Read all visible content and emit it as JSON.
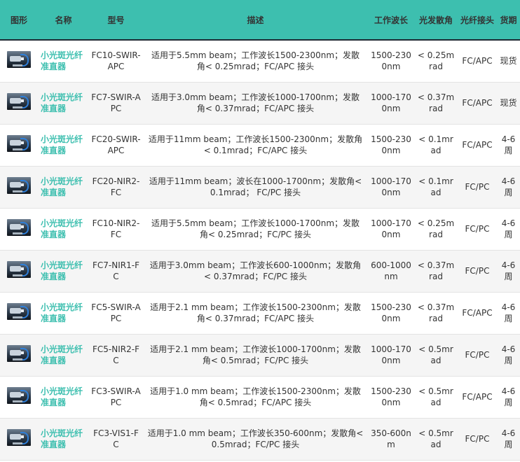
{
  "header": {
    "image": "图形",
    "name": "名称",
    "model": "型号",
    "description": "描述",
    "wavelength": "工作波长",
    "divergence": "光发散角",
    "connector": "光纤接头",
    "lead_time": "货期"
  },
  "rows": [
    {
      "icon": "fiber-collimator-icon",
      "name": "小光斑光纤准直器",
      "model": "FC10-SWIR-APC",
      "description": "适用于5.5mm beam；工作波长1500-2300nm；发散角< 0.25mrad；FC/APC 接头",
      "wavelength": "1500-2300nm",
      "divergence": "< 0.25mrad",
      "connector": "FC/APC",
      "lead_time": "现货"
    },
    {
      "icon": "fiber-collimator-icon",
      "name": "小光斑光纤准直器",
      "model": "FC7-SWIR-APC",
      "description": "适用于3.0mm beam；工作波长1000-1700nm；发散角< 0.37mrad；FC/APC 接头",
      "wavelength": "1000-1700nm",
      "divergence": "< 0.37mrad",
      "connector": "FC/APC",
      "lead_time": "现货"
    },
    {
      "icon": "fiber-collimator-icon",
      "name": "小光斑光纤准直器",
      "model": "FC20-SWIR-APC",
      "description": "适用于11mm beam；工作波长1500-2300nm；发散角< 0.1mrad；FC/APC 接头",
      "wavelength": "1500-2300nm",
      "divergence": "< 0.1mrad",
      "connector": "FC/APC",
      "lead_time": "4-6周"
    },
    {
      "icon": "fiber-collimator-icon",
      "name": "小光斑光纤准直器",
      "model": "FC20-NIR2-FC",
      "description": "适用于11mm beam；波长在1000-1700nm；发散角< 0.1mrad； FC/PC 接头",
      "wavelength": "1000-1700nm",
      "divergence": "< 0.1mrad",
      "connector": "FC/PC",
      "lead_time": "4-6周"
    },
    {
      "icon": "fiber-collimator-icon",
      "name": "小光斑光纤准直器",
      "model": "FC10-NIR2-FC",
      "description": "适用于5.5mm beam；工作波长1000-1700nm；发散角< 0.25mrad；FC/PC 接头",
      "wavelength": "1000-1700nm",
      "divergence": "< 0.25mrad",
      "connector": "FC/PC",
      "lead_time": "4-6周"
    },
    {
      "icon": "fiber-collimator-icon",
      "name": "小光斑光纤准直器",
      "model": "FC7-NIR1-FC",
      "description": "适用于3.0mm beam；工作波长600-1000nm；发散角< 0.37mrad；FC/PC 接头",
      "wavelength": "600-1000nm",
      "divergence": "< 0.37mrad",
      "connector": "FC/PC",
      "lead_time": "4-6周"
    },
    {
      "icon": "fiber-collimator-icon",
      "name": "小光斑光纤准直器",
      "model": "FC5-SWIR-APC",
      "description": "适用于2.1 mm beam；工作波长1500-2300nm；发散角< 0.37mrad；FC/APC 接头",
      "wavelength": "1500-2300nm",
      "divergence": "< 0.37mrad",
      "connector": "FC/APC",
      "lead_time": "4-6周"
    },
    {
      "icon": "fiber-collimator-icon",
      "name": "小光斑光纤准直器",
      "model": "FC5-NIR2-FC",
      "description": "适用于2.1 mm beam；工作波长1000-1700nm；发散角< 0.5mrad；FC/PC 接头",
      "wavelength": "1000-1700nm",
      "divergence": "< 0.5mrad",
      "connector": "FC/PC",
      "lead_time": "4-6周"
    },
    {
      "icon": "fiber-collimator-icon",
      "name": "小光斑光纤准直器",
      "model": "FC3-SWIR-APC",
      "description": "适用于1.0 mm beam；工作波长1500-2300nm；发散角< 0.5mrad；FC/APC 接头",
      "wavelength": "1500-2300nm",
      "divergence": "< 0.5mrad",
      "connector": "FC/APC",
      "lead_time": "4-6周"
    },
    {
      "icon": "fiber-collimator-icon",
      "name": "小光斑光纤准直器",
      "model": "FC3-VIS1-FC",
      "description": "适用于1.0 mm beam；工作波长350-600nm；发散角< 0.5mrad；FC/PC 接头",
      "wavelength": "350-600nm",
      "divergence": "< 0.5mrad",
      "connector": "FC/PC",
      "lead_time": "4-6周"
    }
  ]
}
